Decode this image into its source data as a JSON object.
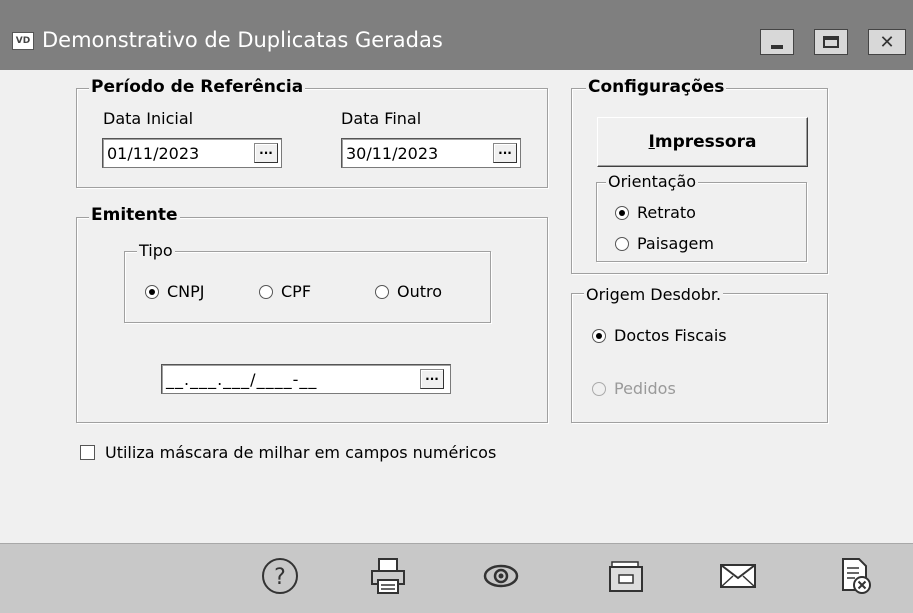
{
  "window": {
    "app_icon": "VD",
    "title": "Demonstrativo de Duplicatas Geradas",
    "controls": [
      "minimize-icon",
      "maximize-icon",
      "close-icon"
    ]
  },
  "periodo": {
    "legend": "Período de Referência",
    "data_inicial_label": "Data Inicial",
    "data_inicial_value": "01/11/2023",
    "data_final_label": "Data Final",
    "data_final_value": "30/11/2023",
    "lookup_label": "···"
  },
  "emitente": {
    "legend": "Emitente",
    "tipo_legend": "Tipo",
    "options": [
      "CNPJ",
      "CPF",
      "Outro"
    ],
    "selected": "CNPJ",
    "mask_value": "__.___.___/____-__"
  },
  "configuracoes": {
    "legend": "Configurações",
    "printer_button": "Impressora",
    "printer_button_access_key": "I",
    "orientacao_legend": "Orientação",
    "orientacao_options": [
      "Retrato",
      "Paisagem"
    ],
    "orientacao_selected": "Retrato"
  },
  "origem": {
    "legend": "Origem Desdobr.",
    "options": [
      "Doctos Fiscais",
      "Pedidos"
    ],
    "selected": "Doctos Fiscais",
    "disabled": [
      "Pedidos"
    ]
  },
  "mascara_checkbox": {
    "label": "Utiliza máscara de milhar em campos numéricos",
    "checked": false
  },
  "toolbar": {
    "icons": [
      "help-icon",
      "print-icon",
      "preview-icon",
      "folder-icon",
      "email-icon",
      "close-document-icon"
    ]
  }
}
